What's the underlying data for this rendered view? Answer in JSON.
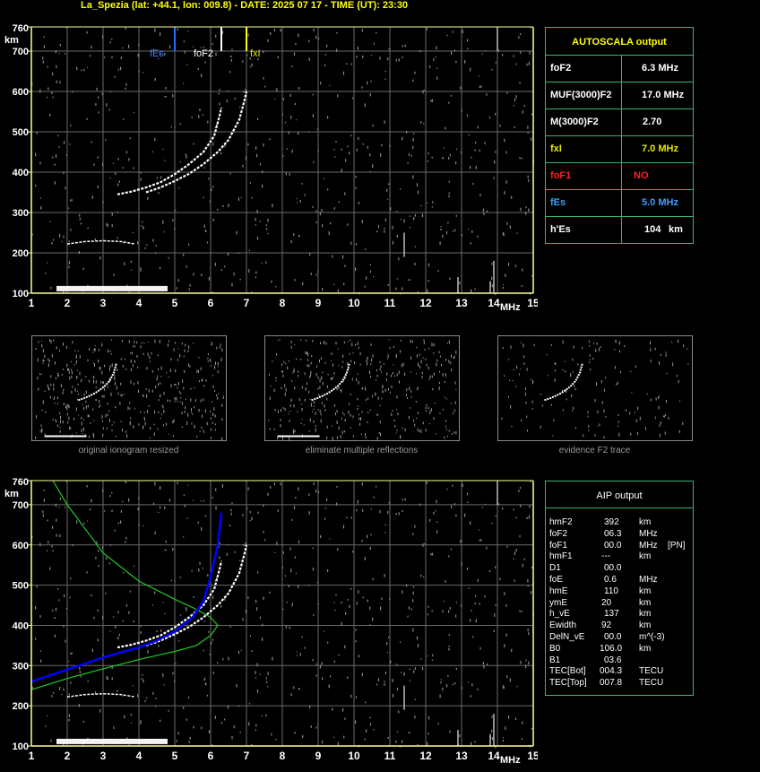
{
  "header": {
    "title": "La_Spezia (lat: +44.1, lon: 009.8) - DATE: 2025 07 17 - TIME (UT): 23:30"
  },
  "colors": {
    "axis": "#ffff99",
    "grid": "#6a6a6a",
    "trace": "#ffffff",
    "noise": "#8a8a8a",
    "fEs_line": "#1e6fff",
    "foF2_line": "#ffffff",
    "fxI_line": "#ffff00",
    "profile_blue": "#0000ff",
    "profile_green": "#22cc22",
    "panel_border": "#3cb371",
    "title_yellow": "#ffff00",
    "foF1_red": "#ff2020",
    "fEs_blue": "#3aa0ff",
    "fxI_yellow": "#e8e800"
  },
  "chart_data": [
    {
      "type": "scatter",
      "name": "main-ionogram",
      "x_tick_labels": [
        "1",
        "2",
        "3",
        "4",
        "5",
        "6",
        "7",
        "8",
        "9",
        "10",
        "11",
        "12",
        "13",
        "14",
        "15"
      ],
      "x_unit": "MHz",
      "y_unit": "km",
      "y_tick_labels": [
        "100",
        "200",
        "300",
        "400",
        "500",
        "600",
        "700",
        "760"
      ],
      "xlim": [
        1,
        15
      ],
      "ylim": [
        100,
        760
      ],
      "grid": true,
      "markers": [
        {
          "label": "fEs",
          "freq": 5.0
        },
        {
          "label": "foF2",
          "freq": 6.3
        },
        {
          "label": "fxI",
          "freq": 7.0
        }
      ],
      "traces": {
        "o_trace": [
          [
            3.4,
            345
          ],
          [
            3.8,
            352
          ],
          [
            4.2,
            362
          ],
          [
            4.6,
            375
          ],
          [
            5.0,
            395
          ],
          [
            5.4,
            420
          ],
          [
            5.8,
            450
          ],
          [
            6.1,
            490
          ],
          [
            6.25,
            540
          ],
          [
            6.3,
            560
          ]
        ],
        "x_trace": [
          [
            4.2,
            350
          ],
          [
            4.6,
            362
          ],
          [
            5.0,
            378
          ],
          [
            5.4,
            396
          ],
          [
            5.8,
            420
          ],
          [
            6.2,
            450
          ],
          [
            6.5,
            480
          ],
          [
            6.8,
            530
          ],
          [
            6.95,
            580
          ],
          [
            7.0,
            600
          ]
        ],
        "e_layer": [
          [
            1.7,
            112
          ],
          [
            2.0,
            112
          ],
          [
            2.5,
            113
          ],
          [
            3.0,
            113
          ],
          [
            3.5,
            114
          ],
          [
            4.0,
            113
          ],
          [
            4.5,
            112
          ],
          [
            4.8,
            112
          ]
        ],
        "multi_reflection": [
          [
            2.0,
            222
          ],
          [
            2.5,
            228
          ],
          [
            3.0,
            230
          ],
          [
            3.5,
            228
          ],
          [
            3.9,
            222
          ]
        ]
      }
    },
    {
      "type": "scatter",
      "name": "aip-ionogram",
      "x_tick_labels": [
        "1",
        "2",
        "3",
        "4",
        "5",
        "6",
        "7",
        "8",
        "9",
        "10",
        "11",
        "12",
        "13",
        "14",
        "15"
      ],
      "x_unit": "MHz",
      "y_unit": "km",
      "y_tick_labels": [
        "100",
        "200",
        "300",
        "400",
        "500",
        "600",
        "700",
        "760"
      ],
      "xlim": [
        1,
        15
      ],
      "ylim": [
        100,
        760
      ],
      "grid": true,
      "profile_blue": [
        [
          1.0,
          260
        ],
        [
          1.5,
          275
        ],
        [
          2.0,
          290
        ],
        [
          2.5,
          305
        ],
        [
          3.0,
          320
        ],
        [
          3.5,
          333
        ],
        [
          4.0,
          345
        ],
        [
          4.5,
          362
        ],
        [
          5.0,
          385
        ],
        [
          5.5,
          420
        ],
        [
          5.8,
          460
        ],
        [
          6.0,
          520
        ],
        [
          6.2,
          600
        ],
        [
          6.3,
          680
        ]
      ],
      "profile_green_lower": [
        [
          1.0,
          240
        ],
        [
          2.0,
          268
        ],
        [
          3.0,
          292
        ],
        [
          4.0,
          315
        ],
        [
          5.0,
          335
        ],
        [
          5.6,
          350
        ],
        [
          6.0,
          375
        ],
        [
          6.2,
          400
        ]
      ],
      "profile_green_upper": [
        [
          1.6,
          760
        ],
        [
          2.0,
          700
        ],
        [
          2.5,
          640
        ],
        [
          3.0,
          580
        ],
        [
          4.0,
          510
        ],
        [
          5.0,
          465
        ],
        [
          5.6,
          440
        ],
        [
          6.0,
          420
        ],
        [
          6.2,
          400
        ]
      ]
    }
  ],
  "autoscala": {
    "title": "AUTOSCALA output",
    "rows": [
      {
        "label": "foF2",
        "value": "6.3 MHz"
      },
      {
        "label": "MUF(3000)F2",
        "value": "17.0 MHz"
      },
      {
        "label": "M(3000)F2",
        "value": "2.70"
      },
      {
        "label": "fxI",
        "value": "7.0 MHz"
      },
      {
        "label": "foF1",
        "value": "NO"
      },
      {
        "label": "fEs",
        "value": "5.0 MHz"
      },
      {
        "label": "h'Es",
        "value": "104",
        "unit": "km"
      }
    ]
  },
  "thumbnails": [
    {
      "caption": "original ionogram resized"
    },
    {
      "caption": "eliminate multiple reflections"
    },
    {
      "caption": "evidence F2 trace"
    }
  ],
  "aip": {
    "title": "AIP output",
    "rows": [
      {
        "label": "hmF2",
        "value": "392",
        "unit": "km",
        "extra": ""
      },
      {
        "label": "foF2",
        "value": "06.3",
        "unit": "MHz",
        "extra": ""
      },
      {
        "label": "foF1",
        "value": "00.0",
        "unit": "MHz",
        "extra": "[PN]"
      },
      {
        "label": "hmF1",
        "value": "---",
        "unit": "km",
        "extra": ""
      },
      {
        "label": "D1",
        "value": "00.0",
        "unit": "",
        "extra": ""
      },
      {
        "label": "foE",
        "value": "0.6",
        "unit": "MHz",
        "extra": ""
      },
      {
        "label": "hmE",
        "value": "110",
        "unit": "km",
        "extra": ""
      },
      {
        "label": "ymE",
        "value": "20",
        "unit": "km",
        "extra": ""
      },
      {
        "label": "h_vE",
        "value": "137",
        "unit": "km",
        "extra": ""
      },
      {
        "label": "Ewidth",
        "value": "92",
        "unit": "km",
        "extra": ""
      },
      {
        "label": "DelN_vE",
        "value": "00.0",
        "unit": "m^(-3)",
        "extra": ""
      },
      {
        "label": "B0",
        "value": "106.0",
        "unit": "km",
        "extra": ""
      },
      {
        "label": "B1",
        "value": "03.6",
        "unit": "",
        "extra": ""
      },
      {
        "label": "TEC[Bot]",
        "value": "004.3",
        "unit": "TECU",
        "extra": ""
      },
      {
        "label": "TEC[Top]",
        "value": "007.8",
        "unit": "TECU",
        "extra": ""
      }
    ]
  }
}
